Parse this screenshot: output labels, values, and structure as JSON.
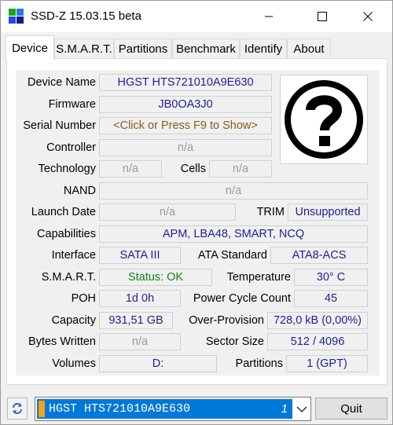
{
  "window": {
    "title": "SSD-Z 15.03.15 beta",
    "icon": "ssd-z-app-icon",
    "controls": {
      "minimize": "minimize-icon",
      "maximize": "maximize-icon",
      "close": "close-icon"
    }
  },
  "tabs": [
    {
      "label": "Device",
      "active": true
    },
    {
      "label": "S.M.A.R.T.",
      "active": false
    },
    {
      "label": "Partitions",
      "active": false
    },
    {
      "label": "Benchmark",
      "active": false
    },
    {
      "label": "Identify",
      "active": false
    },
    {
      "label": "About",
      "active": false
    }
  ],
  "device": {
    "device_name": {
      "label": "Device Name",
      "value": "HGST HTS721010A9E630"
    },
    "firmware": {
      "label": "Firmware",
      "value": "JB0OA3J0"
    },
    "serial_number": {
      "label": "Serial Number",
      "value": "<Click or Press F9 to Show>"
    },
    "controller": {
      "label": "Controller",
      "value": "n/a"
    },
    "technology": {
      "label": "Technology",
      "value": "n/a"
    },
    "cells": {
      "label": "Cells",
      "value": "n/a"
    },
    "nand": {
      "label": "NAND",
      "value": "n/a"
    },
    "launch_date": {
      "label": "Launch Date",
      "value": "n/a"
    },
    "trim": {
      "label": "TRIM",
      "value": "Unsupported"
    },
    "capabilities": {
      "label": "Capabilities",
      "value": "APM, LBA48, SMART, NCQ"
    },
    "interface": {
      "label": "Interface",
      "value": "SATA III"
    },
    "ata_standard": {
      "label": "ATA Standard",
      "value": "ATA8-ACS"
    },
    "smart": {
      "label": "S.M.A.R.T.",
      "value": "Status: OK"
    },
    "temperature": {
      "label": "Temperature",
      "value": "30° C"
    },
    "poh": {
      "label": "POH",
      "value": "1d 0h"
    },
    "power_cycle_count": {
      "label": "Power Cycle Count",
      "value": "45"
    },
    "capacity": {
      "label": "Capacity",
      "value": "931,51 GB"
    },
    "over_provision": {
      "label": "Over-Provision",
      "value": "728,0 kB (0,00%)"
    },
    "bytes_written": {
      "label": "Bytes Written",
      "value": "n/a"
    },
    "sector_size": {
      "label": "Sector Size",
      "value": "512 / 4096"
    },
    "volumes": {
      "label": "Volumes",
      "value": "D:"
    },
    "partitions": {
      "label": "Partitions",
      "value": "1 (GPT)"
    },
    "image_icon": "question-mark-icon"
  },
  "footer": {
    "refresh_icon": "refresh-icon",
    "drive_select": {
      "value": "HGST HTS721010A9E630",
      "index": "1"
    },
    "quit_label": "Quit"
  },
  "colors": {
    "selection": "#0078d7",
    "drive_marker": "#f7a21b",
    "value_blue": "#1f1f9a",
    "value_gray": "#9a9a9a",
    "status_green": "#1a7f1a",
    "serial_brown": "#8a5a1a"
  }
}
